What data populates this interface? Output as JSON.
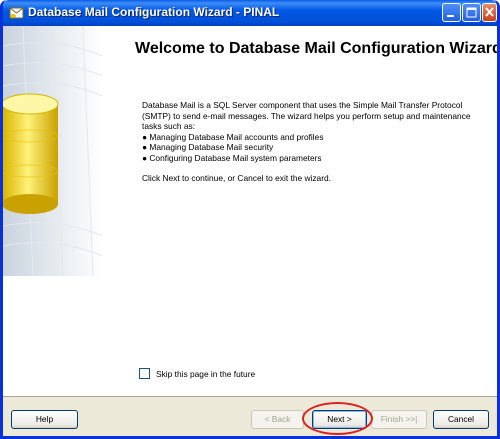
{
  "window": {
    "title": "Database Mail Configuration Wizard - PINAL"
  },
  "page": {
    "heading": "Welcome to Database Mail Configuration Wizard",
    "intro": "Database Mail is a SQL Server component that uses the Simple Mail Transfer Protocol (SMTP) to send e-mail messages. The wizard helps you perform setup and maintenance tasks such as:",
    "bullets": [
      "● Managing Database Mail accounts and profiles",
      "● Managing Database Mail security",
      "● Configuring Database Mail system parameters"
    ],
    "continue_text": "Click Next to continue, or Cancel to exit the wizard.",
    "skip_label": "Skip this page in the future",
    "skip_checked": false
  },
  "buttons": {
    "help": "Help",
    "back": "< Back",
    "next": "Next >",
    "finish": "Finish >>|",
    "cancel": "Cancel"
  },
  "colors": {
    "titlebar": "#0058e6",
    "highlight_ring": "#e02020"
  }
}
